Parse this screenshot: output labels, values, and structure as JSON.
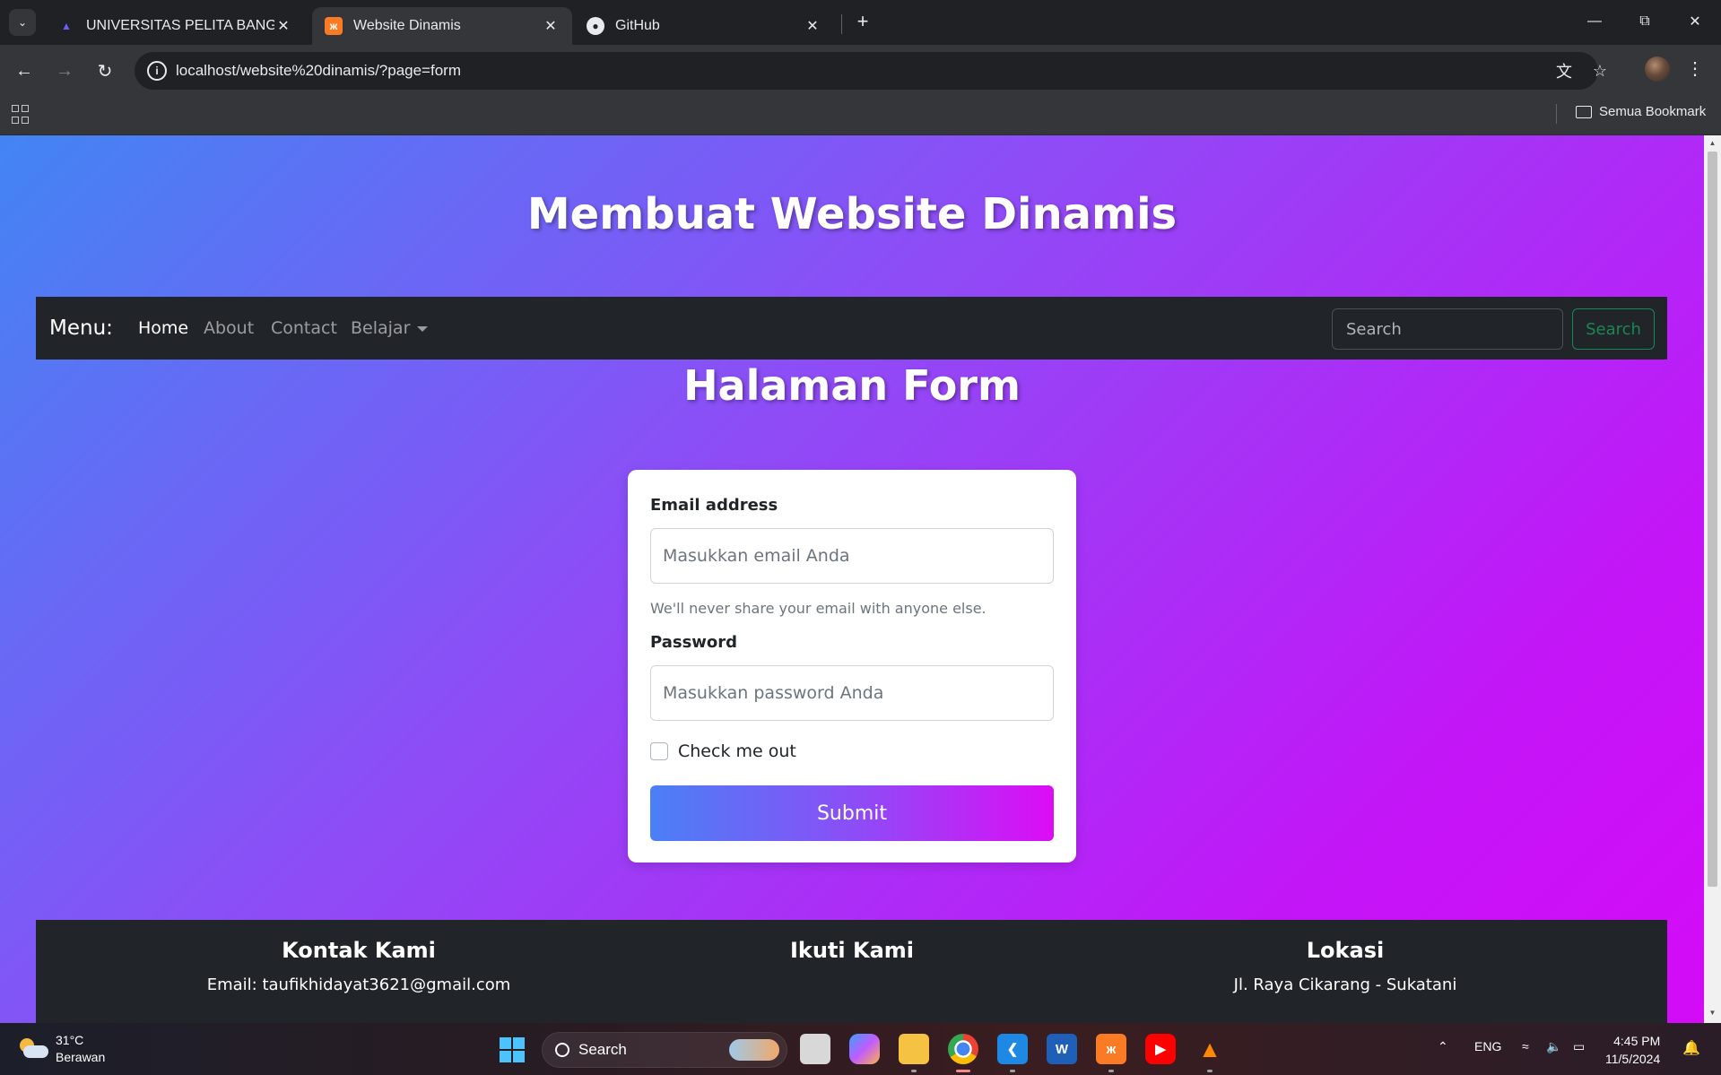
{
  "browser": {
    "tabs": [
      {
        "title": "UNIVERSITAS PELITA BANGSA",
        "active": false
      },
      {
        "title": "Website Dinamis",
        "active": true
      },
      {
        "title": "GitHub",
        "active": false
      }
    ],
    "url": "localhost/website%20dinamis/?page=form",
    "bookmark_all": "Semua Bookmark"
  },
  "page": {
    "site_title": "Membuat Website Dinamis",
    "navbar": {
      "brand": "Menu:",
      "links": [
        "Home",
        "About",
        "Contact",
        "Belajar"
      ],
      "active_link": "Home",
      "search_placeholder": "Search",
      "search_button": "Search"
    },
    "form_heading": "Halaman Form",
    "form": {
      "email_label": "Email address",
      "email_placeholder": "Masukkan email Anda",
      "email_help": "We'll never share your email with anyone else.",
      "password_label": "Password",
      "password_placeholder": "Masukkan password Anda",
      "checkbox_label": "Check me out",
      "submit_label": "Submit"
    },
    "footer": {
      "contact_title": "Kontak Kami",
      "contact_email": "Email: taufikhidayat3621@gmail.com",
      "follow_title": "Ikuti Kami",
      "location_title": "Lokasi",
      "location_address": "Jl. Raya Cikarang - Sukatani"
    }
  },
  "taskbar": {
    "weather_temp": "31°C",
    "weather_desc": "Berawan",
    "search_label": "Search",
    "language": "ENG",
    "time": "4:45 PM",
    "date": "11/5/2024"
  },
  "colors": {
    "gradient_start": "#4285f4",
    "gradient_end": "#d40bf7",
    "navbar_bg": "#212529",
    "search_button": "#198754"
  }
}
